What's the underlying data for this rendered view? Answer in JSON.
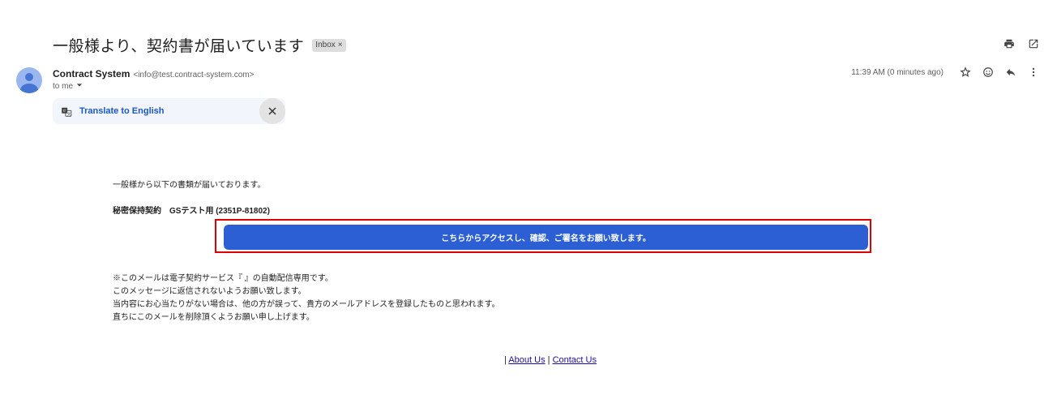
{
  "email": {
    "subject": "一般様より、契約書が届いています",
    "label_chip": "Inbox",
    "label_chip_close": "×",
    "sender_name": "Contract System",
    "sender_email": "<info@test.contract-system.com>",
    "recipient": "to me",
    "timestamp": "11:39 AM (0 minutes ago)"
  },
  "translate": {
    "link_text": "Translate to English",
    "close_icon": "close-icon"
  },
  "body": {
    "intro": "一般様から以下の書類が届いております。",
    "doc_title": "秘密保持契約　GSテスト用 (2351P-81802)",
    "cta_label": "こちらからアクセスし、確認、ご署名をお願い致します。",
    "notice_lines": [
      "※このメールは電子契約サービス『 』の自動配信専用です。",
      "このメッセージに返信されないようお願い致します。",
      "当内容にお心当たりがない場合は、他の方が誤って、貴方のメールアドレスを登録したものと思われます。",
      "直ちにこのメールを削除頂くようお願い申し上げます。"
    ]
  },
  "footer": {
    "separator": "|",
    "about_label": "About Us",
    "contact_label": "Contact Us"
  },
  "icons": {
    "print": "print-icon",
    "open_new_window": "open-in-new-icon",
    "star": "star-icon",
    "emoji": "emoji-icon",
    "reply": "reply-icon",
    "more": "more-vert-icon",
    "dropdown": "chevron-down-icon",
    "translate": "translate-icon"
  },
  "colors": {
    "cta_background": "#2d5fd4",
    "highlight_border": "#e00000",
    "link": "#1a57c7"
  }
}
